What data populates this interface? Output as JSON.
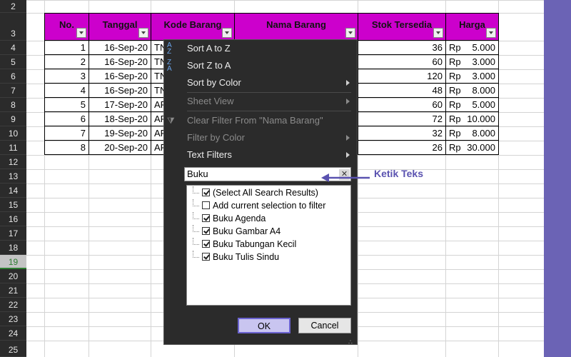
{
  "row_numbers": [
    "2",
    "3",
    "4",
    "5",
    "6",
    "7",
    "8",
    "9",
    "10",
    "11",
    "12",
    "13",
    "14",
    "15",
    "16",
    "17",
    "18",
    "19",
    "20",
    "21",
    "22",
    "23",
    "24",
    "25"
  ],
  "selected_row": "19",
  "headers": [
    "No.",
    "Tanggal",
    "Kode Barang",
    "Nama Barang",
    "Stok Tersedia",
    "Harga"
  ],
  "rows": [
    {
      "no": "1",
      "tanggal": "16-Sep-20",
      "kode": "TN",
      "stok": "36",
      "rp": "Rp",
      "harga": "5.000"
    },
    {
      "no": "2",
      "tanggal": "16-Sep-20",
      "kode": "TN",
      "stok": "60",
      "rp": "Rp",
      "harga": "3.000"
    },
    {
      "no": "3",
      "tanggal": "16-Sep-20",
      "kode": "TN",
      "stok": "120",
      "rp": "Rp",
      "harga": "3.000"
    },
    {
      "no": "4",
      "tanggal": "16-Sep-20",
      "kode": "TN",
      "stok": "48",
      "rp": "Rp",
      "harga": "8.000"
    },
    {
      "no": "5",
      "tanggal": "17-Sep-20",
      "kode": "AP",
      "stok": "60",
      "rp": "Rp",
      "harga": "5.000"
    },
    {
      "no": "6",
      "tanggal": "18-Sep-20",
      "kode": "AP",
      "stok": "72",
      "rp": "Rp",
      "harga": "10.000"
    },
    {
      "no": "7",
      "tanggal": "19-Sep-20",
      "kode": "AP",
      "stok": "32",
      "rp": "Rp",
      "harga": "8.000"
    },
    {
      "no": "8",
      "tanggal": "20-Sep-20",
      "kode": "AP",
      "stok": "26",
      "rp": "Rp",
      "harga": "30.000"
    }
  ],
  "menu": {
    "sort_az": "Sort A to Z",
    "sort_za": "Sort Z to A",
    "sort_color": "Sort by Color",
    "sheet_view": "Sheet View",
    "clear_filter": "Clear Filter From \"Nama Barang\"",
    "filter_color": "Filter by Color",
    "text_filters": "Text Filters"
  },
  "search": {
    "value": "Buku",
    "clear_glyph": "✕"
  },
  "list": [
    {
      "label": "(Select All Search Results)",
      "checked": true
    },
    {
      "label": "Add current selection to filter",
      "checked": false
    },
    {
      "label": "Buku Agenda",
      "checked": true
    },
    {
      "label": "Buku Gambar A4",
      "checked": true
    },
    {
      "label": "Buku Tabungan Kecil",
      "checked": true
    },
    {
      "label": "Buku Tulis Sindu",
      "checked": true
    }
  ],
  "buttons": {
    "ok": "OK",
    "cancel": "Cancel"
  },
  "annotation": {
    "text": "Ketik Teks",
    "color": "#5a52b0"
  },
  "colors": {
    "header_fill": "#cc00cc",
    "background": "#6b63b5",
    "menu_bg": "#2b2b2b"
  }
}
